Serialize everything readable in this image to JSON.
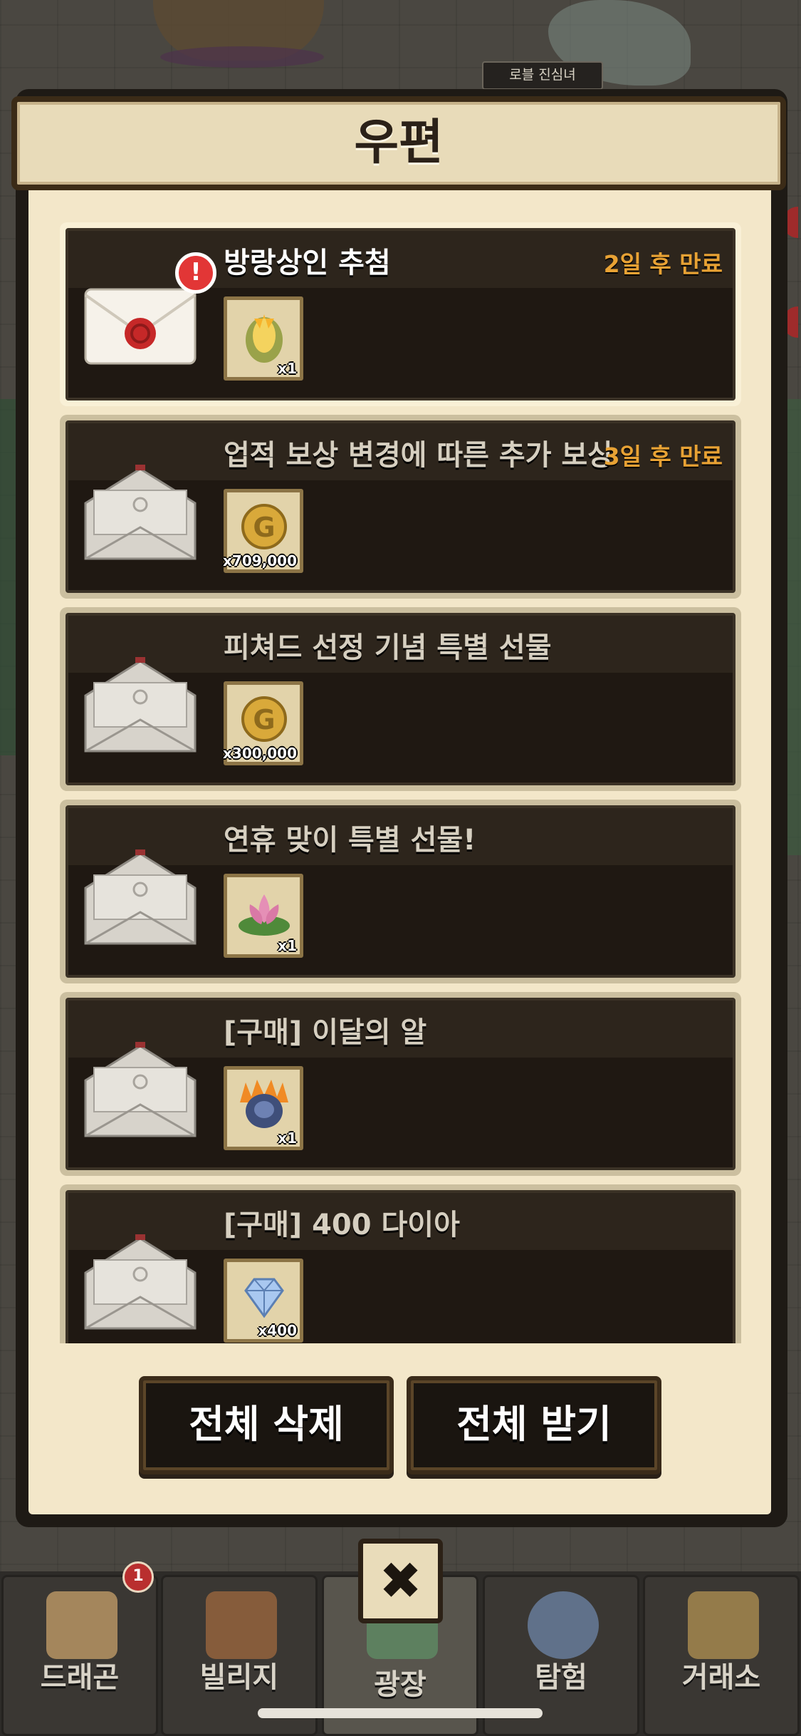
{
  "background": {
    "npc_nametag": "로블 진심녀"
  },
  "modal": {
    "title": "우편",
    "mails": [
      {
        "title": "방랑상인 추첨",
        "expires": "2일 후 만료",
        "unread": true,
        "reward_icon": "golden-egg-icon",
        "reward_qty": "x1"
      },
      {
        "title": "업적 보상 변경에 따른 추가 보상",
        "expires": "3일 후 만료",
        "unread": false,
        "reward_icon": "gold-coin-icon",
        "reward_qty": "x709,000"
      },
      {
        "title": "피쳐드 선정 기념 특별 선물",
        "expires": "",
        "unread": false,
        "reward_icon": "gold-coin-icon",
        "reward_qty": "x300,000"
      },
      {
        "title": "연휴 맞이 특별 선물!",
        "expires": "",
        "unread": false,
        "reward_icon": "lotus-icon",
        "reward_qty": "x1"
      },
      {
        "title": "[구매] 이달의 알",
        "expires": "",
        "unread": false,
        "reward_icon": "fire-egg-icon",
        "reward_qty": "x1"
      },
      {
        "title": "[구매] 400 다이아",
        "expires": "",
        "unread": false,
        "reward_icon": "diamond-icon",
        "reward_qty": "x400"
      }
    ],
    "buttons": {
      "delete_all": "전체 삭제",
      "receive_all": "전체 받기"
    },
    "close_symbol": "✖"
  },
  "nav": {
    "tabs": [
      {
        "label": "드래곤",
        "icon": "dragon-icon",
        "badge": "1"
      },
      {
        "label": "빌리지",
        "icon": "village-icon"
      },
      {
        "label": "광장",
        "icon": "plaza-icon",
        "active": true
      },
      {
        "label": "탐험",
        "icon": "compass-icon"
      },
      {
        "label": "거래소",
        "icon": "scale-icon"
      }
    ]
  },
  "colors": {
    "expire_text": "#e8a234",
    "alert_badge": "#e23636",
    "modal_parchment": "#f3e7c9"
  }
}
